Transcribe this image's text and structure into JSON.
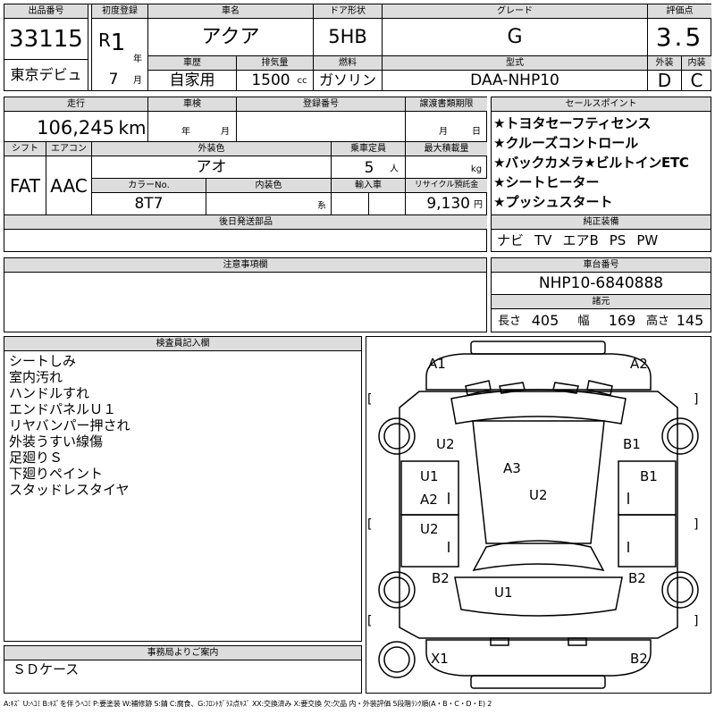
{
  "header": {
    "lot_label": "出品番号",
    "lot": "33115",
    "venue": "東京デビュ",
    "reg_label": "初度登録",
    "era": "R",
    "reg_year": "1",
    "year_unit": "年",
    "reg_month": "7",
    "month_unit": "月",
    "model_label": "車名",
    "model": "アクア",
    "door_label": "ドア形状",
    "door": "5HB",
    "grade_label": "グレード",
    "grade": "G",
    "score_label": "評価点",
    "score": "3.5",
    "history_label": "車歴",
    "history": "自家用",
    "disp_label": "排気量",
    "disp": "1500",
    "disp_unit": "cc",
    "fuel_label": "燃料",
    "fuel": "ガソリン",
    "type_label": "型式",
    "type": "DAA-NHP10",
    "ext_label": "外装",
    "ext": "D",
    "int_label": "内装",
    "int": "C"
  },
  "specs": {
    "mileage_label": "走行",
    "mileage": "106,245",
    "mileage_unit": "km",
    "inspect_label": "車検",
    "year_unit": "年",
    "month_unit": "月",
    "plate_label": "登録番号",
    "transfer_label": "譲渡書類期限",
    "day_unit": "日",
    "shift_label": "シフト",
    "shift": "FAT",
    "ac_label": "エアコン",
    "ac": "AAC",
    "color_label": "外装色",
    "color": "アオ",
    "capacity_label": "乗車定員",
    "capacity": "5",
    "capacity_unit": "人",
    "load_label": "最大積載量",
    "load_unit": "kg",
    "colorno_label": "カラーNo.",
    "colorno": "8T7",
    "intcolor_label": "内装色",
    "intcolor_unit": "系",
    "import_label": "輸入車",
    "recycle_label": "リサイクル預託金",
    "recycle": "9,130",
    "recycle_unit": "円",
    "later_label": "後日発送部品"
  },
  "sales": {
    "label": "セールスポイント",
    "items": [
      "★トヨタセーフティセンス",
      "★クルーズコントロール",
      "★バックカメラ★ビルトインETC",
      "★シートヒーター",
      "★プッシュスタート"
    ]
  },
  "equipment": {
    "label": "純正装備",
    "items": [
      "ナビ",
      "TV",
      "エアB",
      "PS",
      "PW"
    ]
  },
  "notes_label": "注意事項欄",
  "chassis": {
    "label": "車台番号",
    "value": "NHP10-6840888"
  },
  "dims": {
    "label": "諸元",
    "len_label": "長さ",
    "len": "405",
    "wid_label": "幅",
    "wid": "169",
    "hei_label": "高さ",
    "hei": "145"
  },
  "inspector": {
    "label": "検査員記入欄",
    "items": [
      "シートしみ",
      "室内汚れ",
      "ハンドルすれ",
      "エンドパネルＵ１",
      "リヤバンパー押され",
      "外装うすい線傷",
      "足廻りＳ",
      "下廻りペイント",
      "スタッドレスタイヤ"
    ]
  },
  "office": {
    "label": "事務局よりご案内",
    "text": "ＳＤケース"
  },
  "diagram": {
    "marks": [
      "A1",
      "A2",
      "U2",
      "B1",
      "U1",
      "B1",
      "A3",
      "A2",
      "U2",
      "U2",
      "B2",
      "B2",
      "U1",
      "X1",
      "B2"
    ],
    "brackets": [
      "[",
      "]",
      "[",
      "]",
      "[",
      "]"
    ]
  },
  "legend": "A:ｷｽﾞ U:ﾍｺﾐ B:ｷｽﾞを伴うﾍｺﾐ P:要塗装 W:補修跡 S:錆 C:腐食、G:ﾌﾛﾝﾄｶﾞﾗｽ点ｷｽﾞ XX:交換済み X:要交換 欠:欠品 内・外装評価 5段階ﾗﾝｸ順(A・B・C・D・E) 2"
}
